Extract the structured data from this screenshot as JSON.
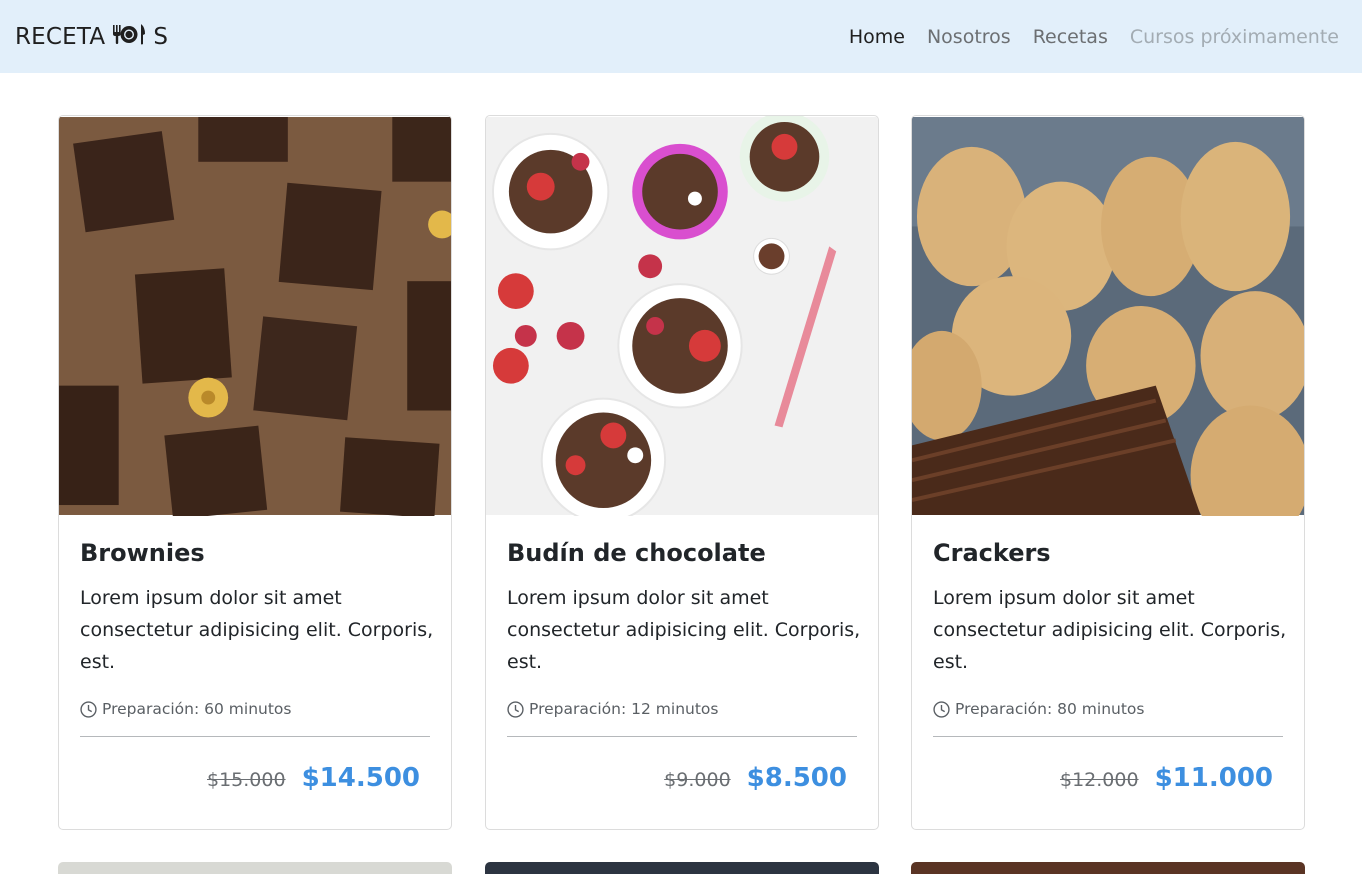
{
  "brand": {
    "text_left": "RECETA",
    "text_right": "S",
    "logo_icon": "plate-fork-knife-icon"
  },
  "nav": {
    "items": [
      {
        "label": "Home",
        "state": "active"
      },
      {
        "label": "Nosotros",
        "state": "normal"
      },
      {
        "label": "Recetas",
        "state": "normal"
      },
      {
        "label": "Cursos próximamente",
        "state": "disabled"
      }
    ]
  },
  "cards": [
    {
      "image": "brownies-photo",
      "title": "Brownies",
      "text": "Lorem ipsum dolor sit amet consectetur adipisicing elit. Corporis, est.",
      "prep": "Preparación: 60 minutos",
      "old_price": "$15.000",
      "new_price": "$14.500"
    },
    {
      "image": "chocolate-pudding-photo",
      "title": "Budín de chocolate",
      "text": "Lorem ipsum dolor sit amet consectetur adipisicing elit. Corporis, est.",
      "prep": "Preparación: 12 minutos",
      "old_price": "$9.000",
      "new_price": "$8.500"
    },
    {
      "image": "crackers-photo",
      "title": "Crackers",
      "text": "Lorem ipsum dolor sit amet consectetur adipisicing elit. Corporis, est.",
      "prep": "Preparación: 80 minutos",
      "old_price": "$12.000",
      "new_price": "$11.000"
    }
  ],
  "colors": {
    "navbar_bg": "#e2effa",
    "price_accent": "#3d8fe0",
    "card_border": "#dcdcdc"
  }
}
